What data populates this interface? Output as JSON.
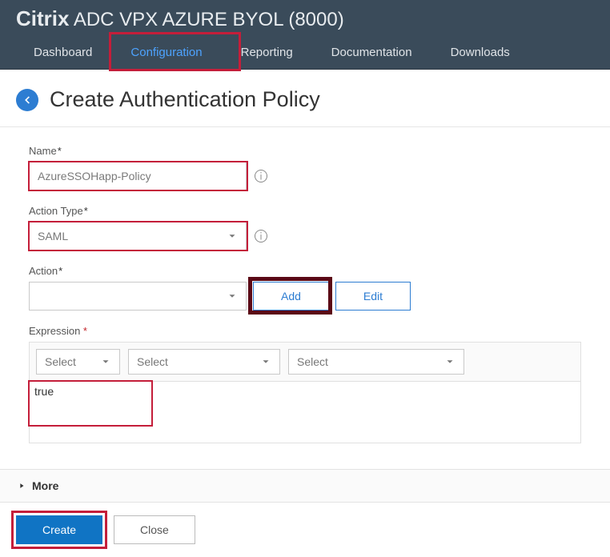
{
  "brand": {
    "strong": "Citrix",
    "rest": " ADC VPX AZURE BYOL (8000)"
  },
  "tabs": {
    "dashboard": "Dashboard",
    "configuration": "Configuration",
    "reporting": "Reporting",
    "documentation": "Documentation",
    "downloads": "Downloads"
  },
  "page": {
    "title": "Create Authentication Policy"
  },
  "labels": {
    "name": "Name",
    "action_type": "Action Type",
    "action": "Action",
    "expression": "Expression",
    "more": "More"
  },
  "fields": {
    "name_value": "AzureSSOHapp-Policy",
    "action_type_value": "SAML",
    "action_value": "",
    "expression_text": "true"
  },
  "select_placeholder": "Select",
  "buttons": {
    "add": "Add",
    "edit": "Edit",
    "create": "Create",
    "close": "Close"
  }
}
